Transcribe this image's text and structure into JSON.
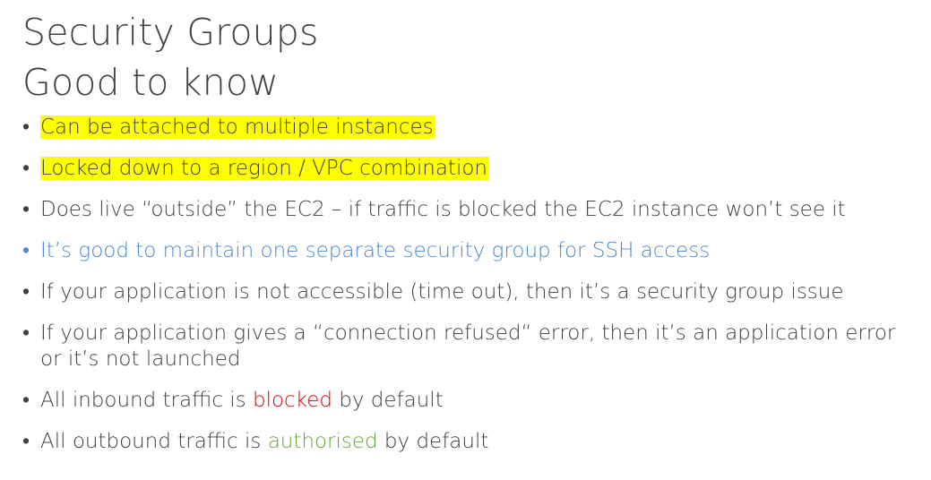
{
  "title": {
    "line1": "Security Groups",
    "line2": "Good to know"
  },
  "bullets": {
    "b1": "Can be attached to multiple instances",
    "b2": "Locked down to a region / VPC combination",
    "b3": "Does live “outside” the EC2 – if traffic is blocked the EC2 instance won’t see it",
    "b4": "It’s good to maintain one separate security group for SSH access",
    "b5": "If your application is not accessible (time out), then it’s a security group issue",
    "b6": "If your application gives a “connection refused“ error, then it’s an application error or it’s not launched",
    "b7": {
      "before": "All inbound traffic is ",
      "emph": "blocked",
      "after": " by default"
    },
    "b8": {
      "before": "All outbound traffic is ",
      "emph": "authorised",
      "after": " by default"
    }
  },
  "colors": {
    "text": "#404040",
    "highlight": "#ffff00",
    "blue": "#4a8ad0",
    "red": "#e00000",
    "green": "#5fa83a"
  }
}
